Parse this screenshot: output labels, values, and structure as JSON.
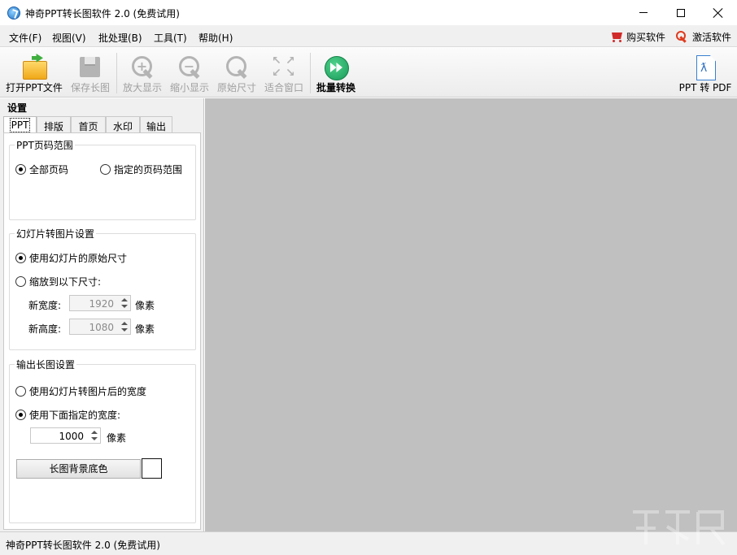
{
  "window": {
    "title": "神奇PPT转长图软件 2.0 (免费试用)"
  },
  "menu": {
    "items": [
      "文件(F)",
      "视图(V)",
      "批处理(B)",
      "工具(T)",
      "帮助(H)"
    ],
    "buy": "购买软件",
    "activate": "激活软件"
  },
  "toolbar": {
    "open": "打开PPT文件",
    "save": "保存长图",
    "zoom_in": "放大显示",
    "zoom_out": "缩小显示",
    "original": "原始尺寸",
    "fit": "适合窗口",
    "batch": "批量转换",
    "pdf": "PPT 转 PDF"
  },
  "panel": {
    "title": "设置",
    "tabs": [
      "PPT",
      "排版",
      "首页",
      "水印",
      "输出"
    ],
    "page_range": {
      "title": "PPT页码范围",
      "all": "全部页码",
      "specified": "指定的页码范围",
      "selected": "all"
    },
    "slide_image": {
      "title": "幻灯片转图片设置",
      "original": "使用幻灯片的原始尺寸",
      "scale": "缩放到以下尺寸:",
      "selected": "original",
      "width_label": "新宽度:",
      "width_value": "1920",
      "height_label": "新高度:",
      "height_value": "1080",
      "unit": "像素"
    },
    "output": {
      "title": "输出长图设置",
      "use_slide_width": "使用幻灯片转图片后的宽度",
      "use_custom_width": "使用下面指定的宽度:",
      "selected": "custom",
      "width_value": "1000",
      "unit": "像素",
      "bg_button": "长图背景底色",
      "bg_color": "#ffffff"
    }
  },
  "status": {
    "text": "神奇PPT转长图软件 2.0 (免费试用)"
  },
  "colors": {
    "canvas": "#c0c0c0",
    "accent_red": "#d12a2a",
    "accent_green": "#1a9a5a"
  }
}
